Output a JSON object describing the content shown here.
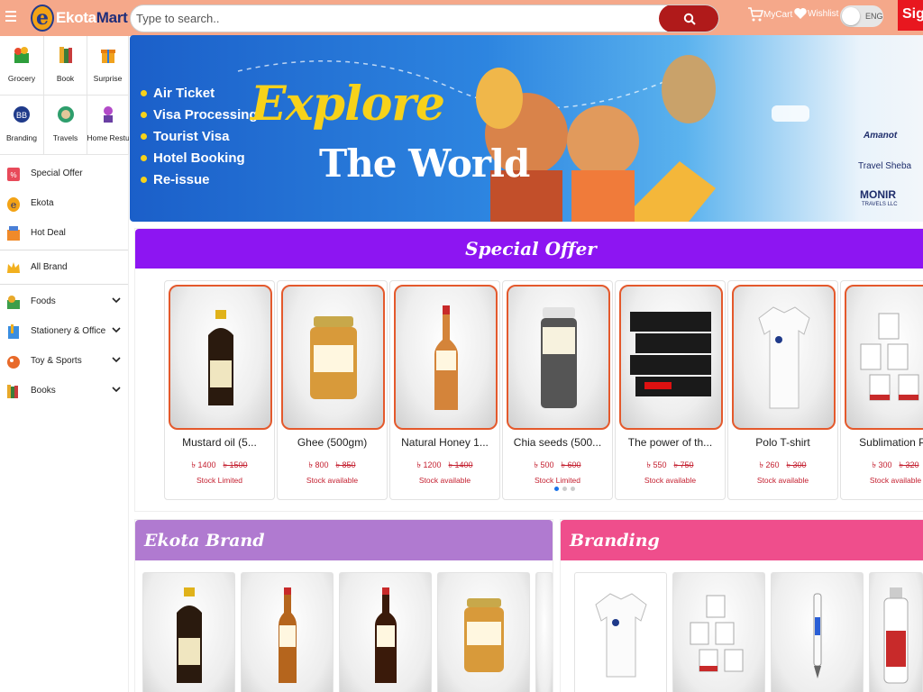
{
  "header": {
    "logo_letter": "e",
    "logo_text_a": "Ekota",
    "logo_text_b": "Mart",
    "search_placeholder": "Type to search..",
    "cart_label": "MyCart",
    "wishlist_label": "Wishlist",
    "language": "ENG",
    "signin_label": "Sign"
  },
  "categories": [
    {
      "label": "Grocery",
      "icon": "grocery-icon"
    },
    {
      "label": "Book",
      "icon": "book-icon"
    },
    {
      "label": "Surprise",
      "icon": "gift-icon"
    },
    {
      "label": "Branding",
      "icon": "branding-icon"
    },
    {
      "label": "Travels",
      "icon": "travel-icon"
    },
    {
      "label": "Home Restu",
      "icon": "chef-icon"
    }
  ],
  "sidebar": {
    "items": [
      {
        "label": "Special Offer",
        "icon": "offer-icon"
      },
      {
        "label": "Ekota",
        "icon": "ekota-icon"
      },
      {
        "label": "Hot Deal",
        "icon": "hot-deal-icon"
      },
      {
        "label": "All Brand",
        "icon": "crown-icon"
      },
      {
        "label": "Foods",
        "icon": "foods-icon"
      },
      {
        "label": "Stationery & Office",
        "icon": "stationery-icon"
      },
      {
        "label": "Toy & Sports",
        "icon": "toy-icon"
      },
      {
        "label": "Books",
        "icon": "books-icon"
      }
    ]
  },
  "banner": {
    "services": [
      "Air Ticket",
      "Visa Processing",
      "Tourist Visa",
      "Hotel Booking",
      "Re-issue"
    ],
    "title_line1": "Explore",
    "title_line2": "The World",
    "partner1": "Amanot",
    "partner2": "Travel Sheba",
    "partner3": "MONIR",
    "partner3_sub": "TRAVELS LLC"
  },
  "special_offer": {
    "title": "Special Offer",
    "products": [
      {
        "name": "Mustard oil (5...",
        "price": "৳ 1400",
        "old_price": "৳ 1500",
        "stock": "Stock Limited"
      },
      {
        "name": "Ghee (500gm)",
        "price": "৳ 800",
        "old_price": "৳ 850",
        "stock": "Stock available"
      },
      {
        "name": "Natural Honey 1...",
        "price": "৳ 1200",
        "old_price": "৳ 1400",
        "stock": "Stock available"
      },
      {
        "name": "Chia seeds (500...",
        "price": "৳ 500",
        "old_price": "৳ 600",
        "stock": "Stock Limited"
      },
      {
        "name": "The power of th...",
        "price": "৳ 550",
        "old_price": "৳ 750",
        "stock": "Stock available"
      },
      {
        "name": "Polo T-shirt",
        "price": "৳ 260",
        "old_price": "৳ 300",
        "stock": "Stock available"
      },
      {
        "name": "Sublimation Pri",
        "price": "৳ 300",
        "old_price": "৳ 320",
        "stock": "Stock available"
      }
    ]
  },
  "ekota_brand": {
    "title": "Ekota Brand",
    "color": "#b07ad0"
  },
  "branding": {
    "title": "Branding",
    "color": "#ef4e8c"
  },
  "colors": {
    "header": "#f5a88a",
    "accent": "#b01a1a",
    "special_offer": "#8d15f2",
    "price": "#c42030"
  }
}
